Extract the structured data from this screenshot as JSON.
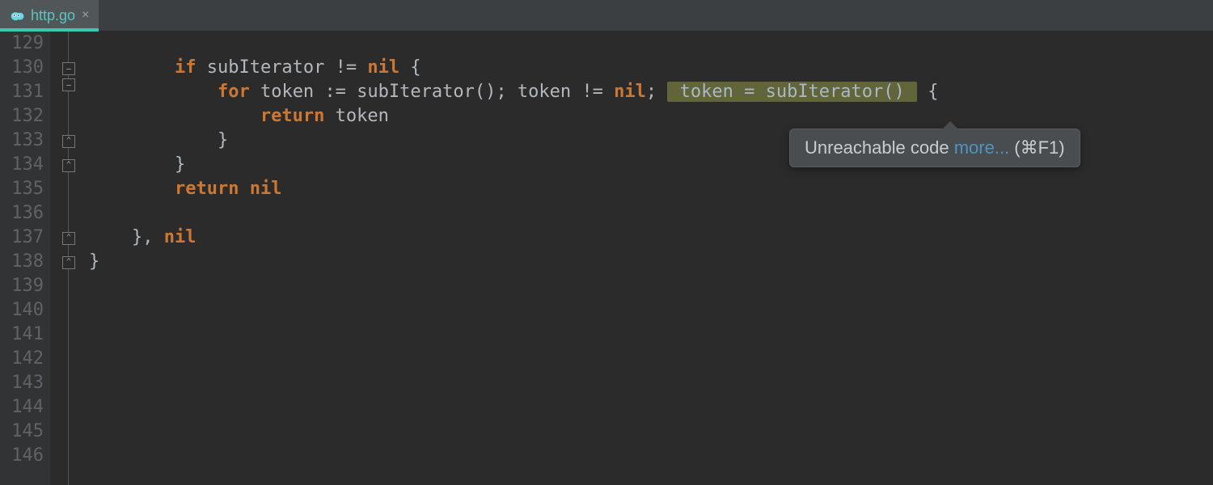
{
  "tab": {
    "filename": "http.go",
    "close_glyph": "×"
  },
  "gutter": {
    "lines": [
      "129",
      "130",
      "131",
      "132",
      "133",
      "134",
      "135",
      "136",
      "137",
      "138",
      "139",
      "140",
      "141",
      "142",
      "143",
      "144",
      "145",
      "146"
    ]
  },
  "code": {
    "l130": {
      "kw_if": "if",
      "id1": "subIterator",
      "op": "!=",
      "nil": "nil",
      "brace": " {"
    },
    "l131": {
      "kw_for": "for",
      "id_token": "token",
      "assign": ":=",
      "fn": "subIterator",
      "parens": "()",
      "semi": ";",
      "id_token2": "token",
      "op": "!=",
      "nil": "nil",
      "semi2": ";",
      "hl": " token = subIterator() ",
      "brace": "{"
    },
    "l132": {
      "kw_return": "return",
      "id_token": "token"
    },
    "l133": {
      "brace": "}"
    },
    "l134": {
      "brace": "}"
    },
    "l135": {
      "kw_return": "return",
      "nil": "nil"
    },
    "l137": {
      "text": "}, ",
      "nil": "nil"
    },
    "l138": {
      "brace": "}"
    }
  },
  "tooltip": {
    "message": "Unreachable code",
    "link": "more...",
    "shortcut": "(⌘F1)"
  }
}
